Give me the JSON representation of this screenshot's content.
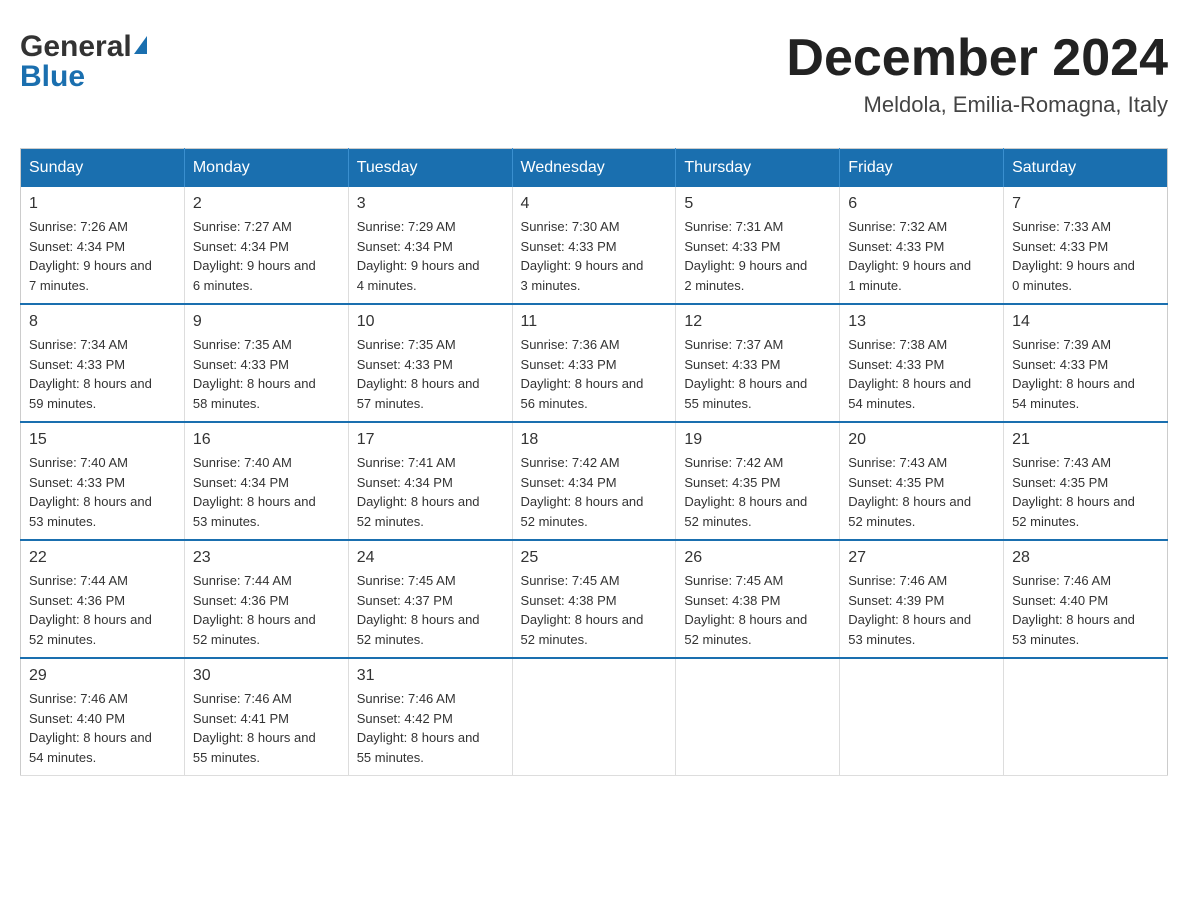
{
  "header": {
    "logo_general": "General",
    "logo_blue": "Blue",
    "month_title": "December 2024",
    "location": "Meldola, Emilia-Romagna, Italy"
  },
  "days_of_week": [
    "Sunday",
    "Monday",
    "Tuesday",
    "Wednesday",
    "Thursday",
    "Friday",
    "Saturday"
  ],
  "weeks": [
    [
      {
        "day": "1",
        "sunrise": "7:26 AM",
        "sunset": "4:34 PM",
        "daylight": "9 hours and 7 minutes."
      },
      {
        "day": "2",
        "sunrise": "7:27 AM",
        "sunset": "4:34 PM",
        "daylight": "9 hours and 6 minutes."
      },
      {
        "day": "3",
        "sunrise": "7:29 AM",
        "sunset": "4:34 PM",
        "daylight": "9 hours and 4 minutes."
      },
      {
        "day": "4",
        "sunrise": "7:30 AM",
        "sunset": "4:33 PM",
        "daylight": "9 hours and 3 minutes."
      },
      {
        "day": "5",
        "sunrise": "7:31 AM",
        "sunset": "4:33 PM",
        "daylight": "9 hours and 2 minutes."
      },
      {
        "day": "6",
        "sunrise": "7:32 AM",
        "sunset": "4:33 PM",
        "daylight": "9 hours and 1 minute."
      },
      {
        "day": "7",
        "sunrise": "7:33 AM",
        "sunset": "4:33 PM",
        "daylight": "9 hours and 0 minutes."
      }
    ],
    [
      {
        "day": "8",
        "sunrise": "7:34 AM",
        "sunset": "4:33 PM",
        "daylight": "8 hours and 59 minutes."
      },
      {
        "day": "9",
        "sunrise": "7:35 AM",
        "sunset": "4:33 PM",
        "daylight": "8 hours and 58 minutes."
      },
      {
        "day": "10",
        "sunrise": "7:35 AM",
        "sunset": "4:33 PM",
        "daylight": "8 hours and 57 minutes."
      },
      {
        "day": "11",
        "sunrise": "7:36 AM",
        "sunset": "4:33 PM",
        "daylight": "8 hours and 56 minutes."
      },
      {
        "day": "12",
        "sunrise": "7:37 AM",
        "sunset": "4:33 PM",
        "daylight": "8 hours and 55 minutes."
      },
      {
        "day": "13",
        "sunrise": "7:38 AM",
        "sunset": "4:33 PM",
        "daylight": "8 hours and 54 minutes."
      },
      {
        "day": "14",
        "sunrise": "7:39 AM",
        "sunset": "4:33 PM",
        "daylight": "8 hours and 54 minutes."
      }
    ],
    [
      {
        "day": "15",
        "sunrise": "7:40 AM",
        "sunset": "4:33 PM",
        "daylight": "8 hours and 53 minutes."
      },
      {
        "day": "16",
        "sunrise": "7:40 AM",
        "sunset": "4:34 PM",
        "daylight": "8 hours and 53 minutes."
      },
      {
        "day": "17",
        "sunrise": "7:41 AM",
        "sunset": "4:34 PM",
        "daylight": "8 hours and 52 minutes."
      },
      {
        "day": "18",
        "sunrise": "7:42 AM",
        "sunset": "4:34 PM",
        "daylight": "8 hours and 52 minutes."
      },
      {
        "day": "19",
        "sunrise": "7:42 AM",
        "sunset": "4:35 PM",
        "daylight": "8 hours and 52 minutes."
      },
      {
        "day": "20",
        "sunrise": "7:43 AM",
        "sunset": "4:35 PM",
        "daylight": "8 hours and 52 minutes."
      },
      {
        "day": "21",
        "sunrise": "7:43 AM",
        "sunset": "4:35 PM",
        "daylight": "8 hours and 52 minutes."
      }
    ],
    [
      {
        "day": "22",
        "sunrise": "7:44 AM",
        "sunset": "4:36 PM",
        "daylight": "8 hours and 52 minutes."
      },
      {
        "day": "23",
        "sunrise": "7:44 AM",
        "sunset": "4:36 PM",
        "daylight": "8 hours and 52 minutes."
      },
      {
        "day": "24",
        "sunrise": "7:45 AM",
        "sunset": "4:37 PM",
        "daylight": "8 hours and 52 minutes."
      },
      {
        "day": "25",
        "sunrise": "7:45 AM",
        "sunset": "4:38 PM",
        "daylight": "8 hours and 52 minutes."
      },
      {
        "day": "26",
        "sunrise": "7:45 AM",
        "sunset": "4:38 PM",
        "daylight": "8 hours and 52 minutes."
      },
      {
        "day": "27",
        "sunrise": "7:46 AM",
        "sunset": "4:39 PM",
        "daylight": "8 hours and 53 minutes."
      },
      {
        "day": "28",
        "sunrise": "7:46 AM",
        "sunset": "4:40 PM",
        "daylight": "8 hours and 53 minutes."
      }
    ],
    [
      {
        "day": "29",
        "sunrise": "7:46 AM",
        "sunset": "4:40 PM",
        "daylight": "8 hours and 54 minutes."
      },
      {
        "day": "30",
        "sunrise": "7:46 AM",
        "sunset": "4:41 PM",
        "daylight": "8 hours and 55 minutes."
      },
      {
        "day": "31",
        "sunrise": "7:46 AM",
        "sunset": "4:42 PM",
        "daylight": "8 hours and 55 minutes."
      },
      null,
      null,
      null,
      null
    ]
  ],
  "labels": {
    "sunrise": "Sunrise:",
    "sunset": "Sunset:",
    "daylight": "Daylight:"
  }
}
